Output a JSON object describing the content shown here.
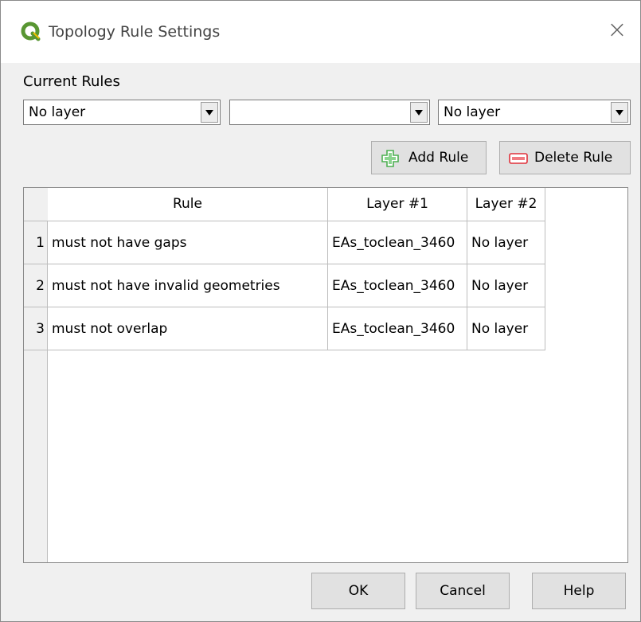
{
  "window": {
    "title": "Topology Rule Settings",
    "close_symbol": "×"
  },
  "current_rules": {
    "label": "Current Rules",
    "combo1_value": "No layer",
    "combo2_value": "",
    "combo3_value": "No layer"
  },
  "toolbar": {
    "add_rule_label": "Add Rule",
    "delete_rule_label": "Delete Rule"
  },
  "table": {
    "columns": [
      "Rule",
      "Layer #1",
      "Layer #2"
    ],
    "rows": [
      {
        "num": "1",
        "rule": "must not have gaps",
        "layer1": "EAs_toclean_3460",
        "layer2": "No layer"
      },
      {
        "num": "2",
        "rule": "must not have invalid geometries",
        "layer1": "EAs_toclean_3460",
        "layer2": "No layer"
      },
      {
        "num": "3",
        "rule": "must not overlap",
        "layer1": "EAs_toclean_3460",
        "layer2": "No layer"
      }
    ]
  },
  "buttons": {
    "ok_label": "OK",
    "cancel_label": "Cancel",
    "help_label": "Help"
  },
  "colors": {
    "qgis_green": "#589632",
    "add_green": "#4caf50",
    "delete_red": "#e0303a"
  }
}
